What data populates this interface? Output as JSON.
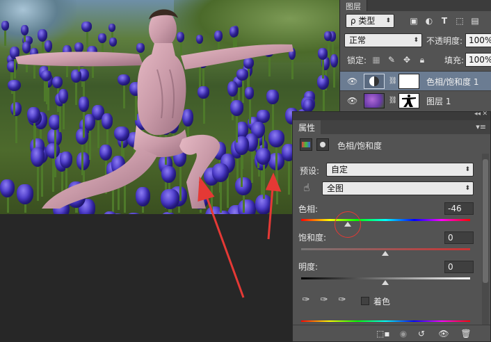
{
  "layers_panel": {
    "tab_label": "图层",
    "kind_filter": "ρ 类型",
    "blend_mode": "正常",
    "opacity_label": "不透明度:",
    "opacity_value": "100%",
    "lock_label": "锁定:",
    "fill_label": "填充:",
    "fill_value": "100%",
    "layers": [
      {
        "name": "色相/饱和度 1",
        "selected": true
      },
      {
        "name": "图层 1",
        "selected": false
      }
    ]
  },
  "properties_panel": {
    "tab_label": "属性",
    "adjustment_title": "色相/饱和度",
    "preset_label": "预设:",
    "preset_value": "自定",
    "channel_value": "全图",
    "hue_label": "色相:",
    "hue_value": "-46",
    "saturation_label": "饱和度:",
    "saturation_value": "0",
    "lightness_label": "明度:",
    "lightness_value": "0",
    "colorize_label": "着色"
  },
  "colors": {
    "panel_bg": "#535353",
    "selected_layer": "#6b7c92",
    "annotation_red": "#e53935",
    "tulip_blue": "#4a39c8"
  }
}
